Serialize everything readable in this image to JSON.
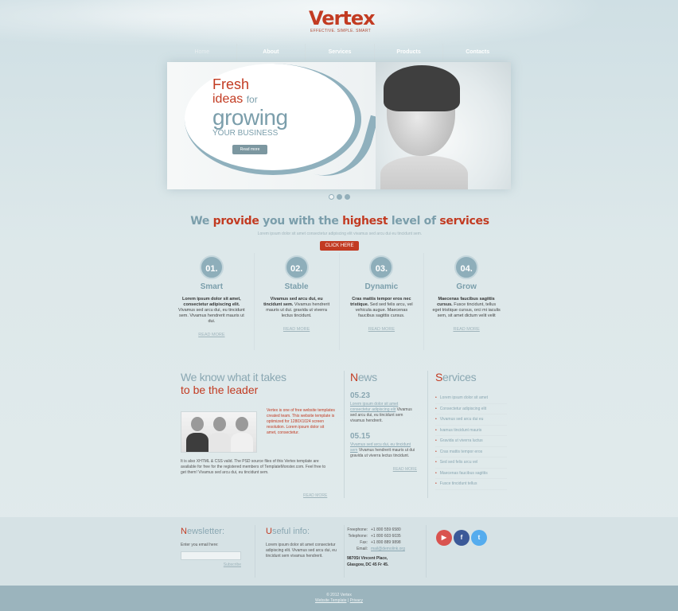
{
  "brand": {
    "name": "Vertex",
    "tagline": "EFFECTIVE. SIMPLE. SMART"
  },
  "nav": [
    "Home",
    "About",
    "Services",
    "Products",
    "Contacts"
  ],
  "slider": {
    "line1": "Fresh",
    "line2_red": "ideas",
    "line2_blue": "for",
    "line3": "growing",
    "line4": "YOUR BUSINESS",
    "button": "Read more",
    "slides": 3
  },
  "intro": {
    "headline_parts": [
      "We",
      "provide",
      "you with the",
      "highest",
      "level of",
      "services"
    ],
    "subline": "Lorem ipsum dolor sit amet consectetur adipiscing elit vivamus sed arcu dui eu tincidunt sem.",
    "button": "CLICK HERE"
  },
  "features": [
    {
      "num": "01.",
      "title": "Smart",
      "bold": "Lorem ipsum dolor sit amet, consectetur adipiscing elit.",
      "text": "Vivamus sed arcu dui, eu tincidunt sem. Vivamus hendrerit mauris ut dui.",
      "link": "READ MORE"
    },
    {
      "num": "02.",
      "title": "Stable",
      "bold": "Vivamus sed arcu dui, eu tincidunt sem.",
      "text": "Vivamus hendrerit mauris ut dui. gravida ut viverra lectus tincidunt.",
      "link": "READ MORE"
    },
    {
      "num": "03.",
      "title": "Dynamic",
      "bold": "Cras mattis tempor eros nec tristique.",
      "text": "Sed sed felis arcu, vel vehicula augue. Maecenas faucibus sagittis cursus.",
      "link": "READ MORE"
    },
    {
      "num": "04.",
      "title": "Grow",
      "bold": "Maecenas faucibus sagittis cursus.",
      "text": "Fusce tincidunt, tellus eget tristique cursus, orci mi iaculis sem, sit amet dictum velit velit",
      "link": "READ MORE"
    }
  ],
  "about": {
    "title1": "We know what it takes",
    "title2": "to be the leader",
    "side_text": "Vertex is one of free website templates created team. This website template is optimized for 1280X1024 screen resolution. Lorem ipsum dolor sit amet, consectetur.",
    "body": "It is also XHTML & CSS valid. The PSD source files of this Vertex template are available for free for the registered members of TemplateMonster.com. Feel free to get them! Vivamus sed arcu dui, eu tincidunt sem.",
    "more": "READ MORE"
  },
  "news": {
    "title_cap": "N",
    "title_rest": "ews",
    "items": [
      {
        "date": "05.23",
        "link": "Lorem ipsum dolor sit amet consectetur adipiscing elit",
        "text": "Vivamus sed arcu dui, eu tincidunt sem vivamus hendrerit."
      },
      {
        "date": "05.15",
        "link": "Vivamus sed arcu dui, eu tincidunt sem",
        "text": "Vivamus hendrerit mauris ut dui gravida ut viverra lectus tincidunt."
      }
    ],
    "more": "READ MORE"
  },
  "services": {
    "title_cap": "S",
    "title_rest": "ervices",
    "items": [
      "Lorem ipsum dolor sit amet",
      "Consectetur adipiscing elit",
      "Vivamus sed arcu dui eu",
      "Ivamus tincidunt mauris",
      "Gravida ut viverra luctus",
      "Cras mattis tempor eros",
      "Sed sed felis arcu vel",
      "Maecenas faucibus sagittis",
      "Fusce tincidunt tellus"
    ]
  },
  "newsletter": {
    "title_cap": "N",
    "title_rest": "ewsletter:",
    "label": "Enter you email here:",
    "submit": "Subscribe"
  },
  "useful": {
    "title_cap": "U",
    "title_rest": "seful info:",
    "text": "Lorem ipsum dolor sit amet consectetur adipiscing elit. Vivamus sed arcu dui, eu tincidunt sem vivamus hendrerit."
  },
  "contacts": {
    "rows": [
      {
        "label": "Freephone:",
        "value": "+1 800 559 6580"
      },
      {
        "label": "Telephone:",
        "value": "+1 800 603 6035"
      },
      {
        "label": "Fax:",
        "value": "+1 800 889 9898"
      },
      {
        "label": "Email:",
        "value": "mail@demolink.org"
      }
    ],
    "address1": "9870St Vincent Place,",
    "address2": "Glasgow, DC 45 Fr 45."
  },
  "social": [
    {
      "icon": "youtube-icon",
      "glyph": "▶",
      "color": "#d9534f"
    },
    {
      "icon": "facebook-icon",
      "glyph": "f",
      "color": "#3b5998"
    },
    {
      "icon": "twitter-icon",
      "glyph": "t",
      "color": "#55acee"
    }
  ],
  "footer": {
    "copyright": "© 2012 Vertex",
    "link1": "Website Template",
    "sep": "|",
    "link2": "Privacy"
  },
  "colors": {
    "accent": "#c23b22",
    "blue": "#7b9eab"
  }
}
